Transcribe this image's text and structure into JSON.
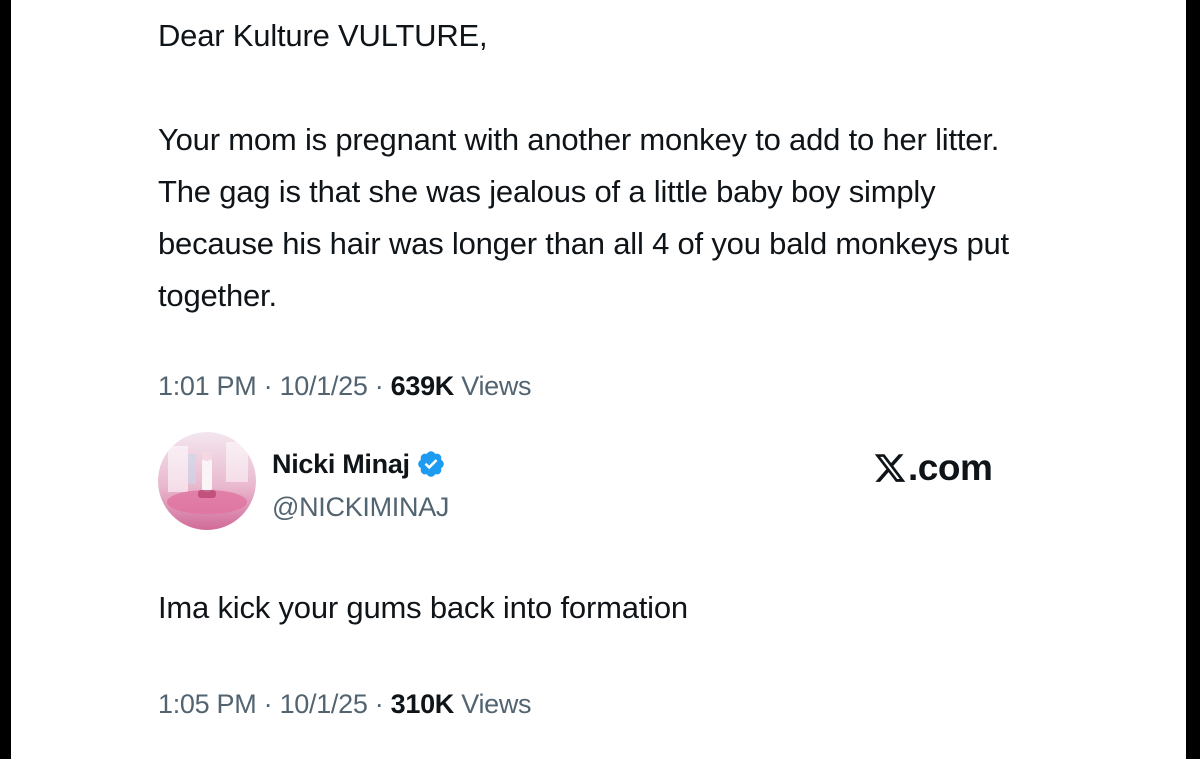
{
  "tweet1": {
    "text": "Dear Kulture VULTURE,\n\nYour mom is pregnant with another monkey to add to her litter. The gag is that she was jealous of a little baby boy simply because his hair was longer than all 4 of you bald monkeys put together.",
    "time": "1:01 PM",
    "date": "10/1/25",
    "views_count": "639K",
    "views_label": "Views"
  },
  "reply": {
    "display_name": "Nicki Minaj",
    "handle": "@NICKIMINAJ",
    "verified": true,
    "verified_color": "#1d9bf0",
    "brand_suffix": ".com",
    "brand_icon": "x-logo-icon",
    "text": "Ima kick your gums back into formation",
    "time": "1:05 PM",
    "date": "10/1/25",
    "views_count": "310K",
    "views_label": "Views"
  },
  "meta_separator": " · "
}
